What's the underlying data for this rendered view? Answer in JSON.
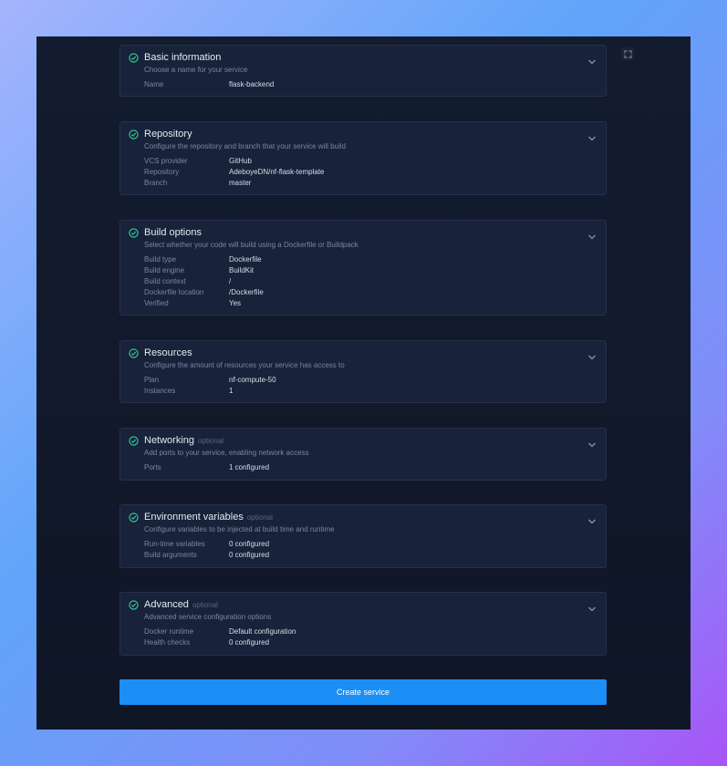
{
  "colors": {
    "accent": "#1b8ff5",
    "success": "#34d399",
    "card_bg": "#18223a",
    "window_bg": "#111a2c"
  },
  "icons": {
    "section_status": "check-circle-icon",
    "section_toggle": "chevron-down-icon",
    "window_control": "expand-icon"
  },
  "sections": [
    {
      "title": "Basic information",
      "optional": "",
      "description": "Choose a name for your service",
      "rows": [
        {
          "label": "Name",
          "value": "flask-backend"
        }
      ]
    },
    {
      "title": "Repository",
      "optional": "",
      "description": "Configure the repository and branch that your service will build",
      "rows": [
        {
          "label": "VCS provider",
          "value": "GitHub"
        },
        {
          "label": "Repository",
          "value": "AdeboyeDN/nf-flask-template"
        },
        {
          "label": "Branch",
          "value": "master"
        }
      ]
    },
    {
      "title": "Build options",
      "optional": "",
      "description": "Select whether your code will build using a Dockerfile or Buildpack",
      "rows": [
        {
          "label": "Build type",
          "value": "Dockerfile"
        },
        {
          "label": "Build engine",
          "value": "BuildKit"
        },
        {
          "label": "Build context",
          "value": "/"
        },
        {
          "label": "Dockerfile location",
          "value": "/Dockerfile"
        },
        {
          "label": "Verified",
          "value": "Yes"
        }
      ]
    },
    {
      "title": "Resources",
      "optional": "",
      "description": "Configure the amount of resources your service has access to",
      "rows": [
        {
          "label": "Plan",
          "value": "nf-compute-50"
        },
        {
          "label": "Instances",
          "value": "1"
        }
      ]
    },
    {
      "title": "Networking",
      "optional": "optional",
      "description": "Add ports to your service, enabling network access",
      "rows": [
        {
          "label": "Ports",
          "value": "1 configured"
        }
      ]
    },
    {
      "title": "Environment variables",
      "optional": "optional",
      "description": "Configure variables to be injected at build time and runtime",
      "rows": [
        {
          "label": "Run-time variables",
          "value": "0 configured"
        },
        {
          "label": "Build arguments",
          "value": "0 configured"
        }
      ]
    },
    {
      "title": "Advanced",
      "optional": "optional",
      "description": "Advanced service configuration options",
      "rows": [
        {
          "label": "Docker runtime",
          "value": "Default configuration"
        },
        {
          "label": "Health checks",
          "value": "0 configured"
        }
      ]
    }
  ],
  "create_button": {
    "label": "Create service"
  }
}
